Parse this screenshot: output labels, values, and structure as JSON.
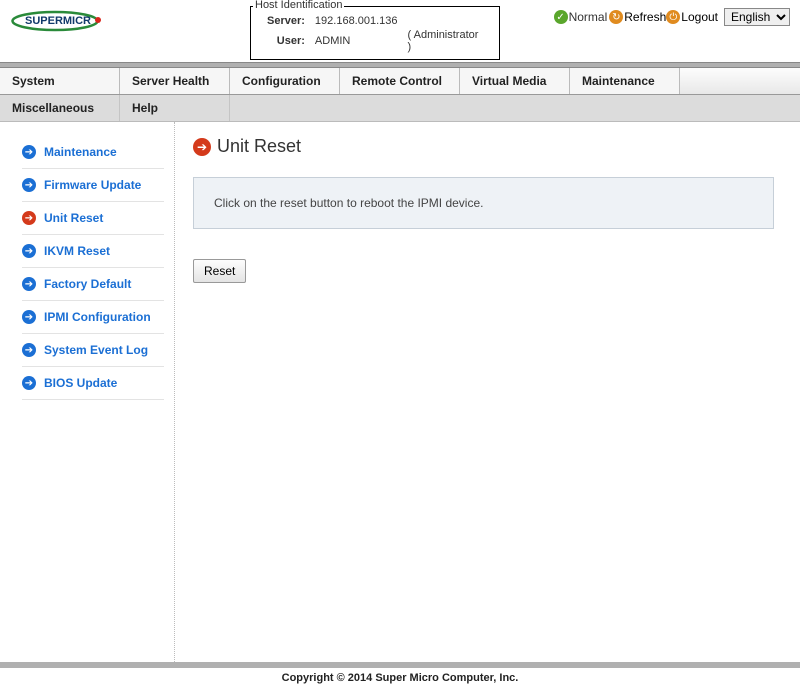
{
  "host_id": {
    "legend": "Host Identification",
    "server_label": "Server:",
    "server_value": "192.168.001.136",
    "user_label": "User:",
    "user_value": "ADMIN",
    "role": "( Administrator )"
  },
  "top": {
    "status": "Normal",
    "refresh": "Refresh",
    "logout": "Logout",
    "lang_options": [
      "English"
    ],
    "lang_selected": "English"
  },
  "menu": {
    "system": "System",
    "server_health": "Server Health",
    "configuration": "Configuration",
    "remote_control": "Remote Control",
    "virtual_media": "Virtual Media",
    "maintenance": "Maintenance"
  },
  "menu2": {
    "misc": "Miscellaneous",
    "help": "Help"
  },
  "sidebar": {
    "items": [
      {
        "label": "Maintenance",
        "active": false
      },
      {
        "label": "Firmware Update",
        "active": false
      },
      {
        "label": "Unit Reset",
        "active": true
      },
      {
        "label": "IKVM Reset",
        "active": false
      },
      {
        "label": "Factory Default",
        "active": false
      },
      {
        "label": "IPMI Configuration",
        "active": false
      },
      {
        "label": "System Event Log",
        "active": false
      },
      {
        "label": "BIOS Update",
        "active": false
      }
    ]
  },
  "page": {
    "title": "Unit Reset",
    "info": "Click on the reset button to reboot the IPMI device.",
    "reset_btn": "Reset"
  },
  "footer": "Copyright © 2014 Super Micro Computer, Inc."
}
